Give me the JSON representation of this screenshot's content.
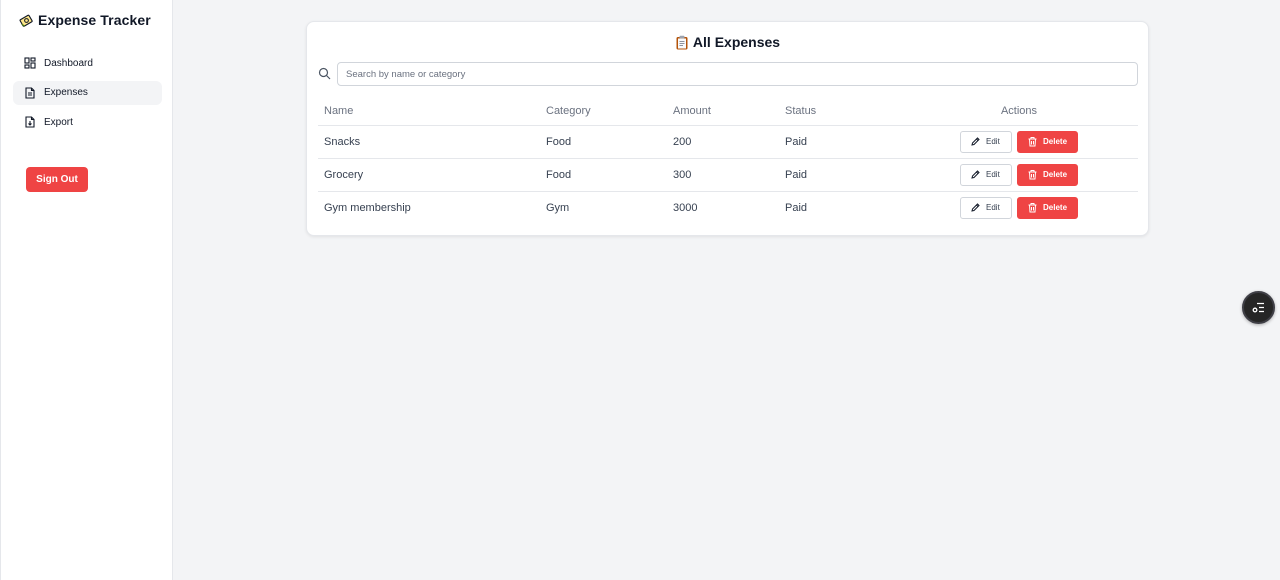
{
  "sidebar": {
    "brand": "Expense Tracker",
    "items": [
      {
        "label": "Dashboard",
        "icon": "dashboard-icon"
      },
      {
        "label": "Expenses",
        "icon": "file-text-icon"
      },
      {
        "label": "Export",
        "icon": "file-download-icon"
      }
    ],
    "sign_out": "Sign Out"
  },
  "main": {
    "title": "All Expenses",
    "search": {
      "placeholder": "Search by name or category",
      "value": ""
    },
    "columns": [
      "Name",
      "Category",
      "Amount",
      "Status",
      "Actions"
    ],
    "rows": [
      {
        "name": "Snacks",
        "category": "Food",
        "amount": "200",
        "status": "Paid"
      },
      {
        "name": "Grocery",
        "category": "Food",
        "amount": "300",
        "status": "Paid"
      },
      {
        "name": "Gym membership",
        "category": "Gym",
        "amount": "3000",
        "status": "Paid"
      }
    ],
    "edit_label": "Edit",
    "delete_label": "Delete"
  },
  "colors": {
    "accent_red": "#ef4444",
    "background": "#f3f4f6",
    "surface": "#ffffff"
  }
}
